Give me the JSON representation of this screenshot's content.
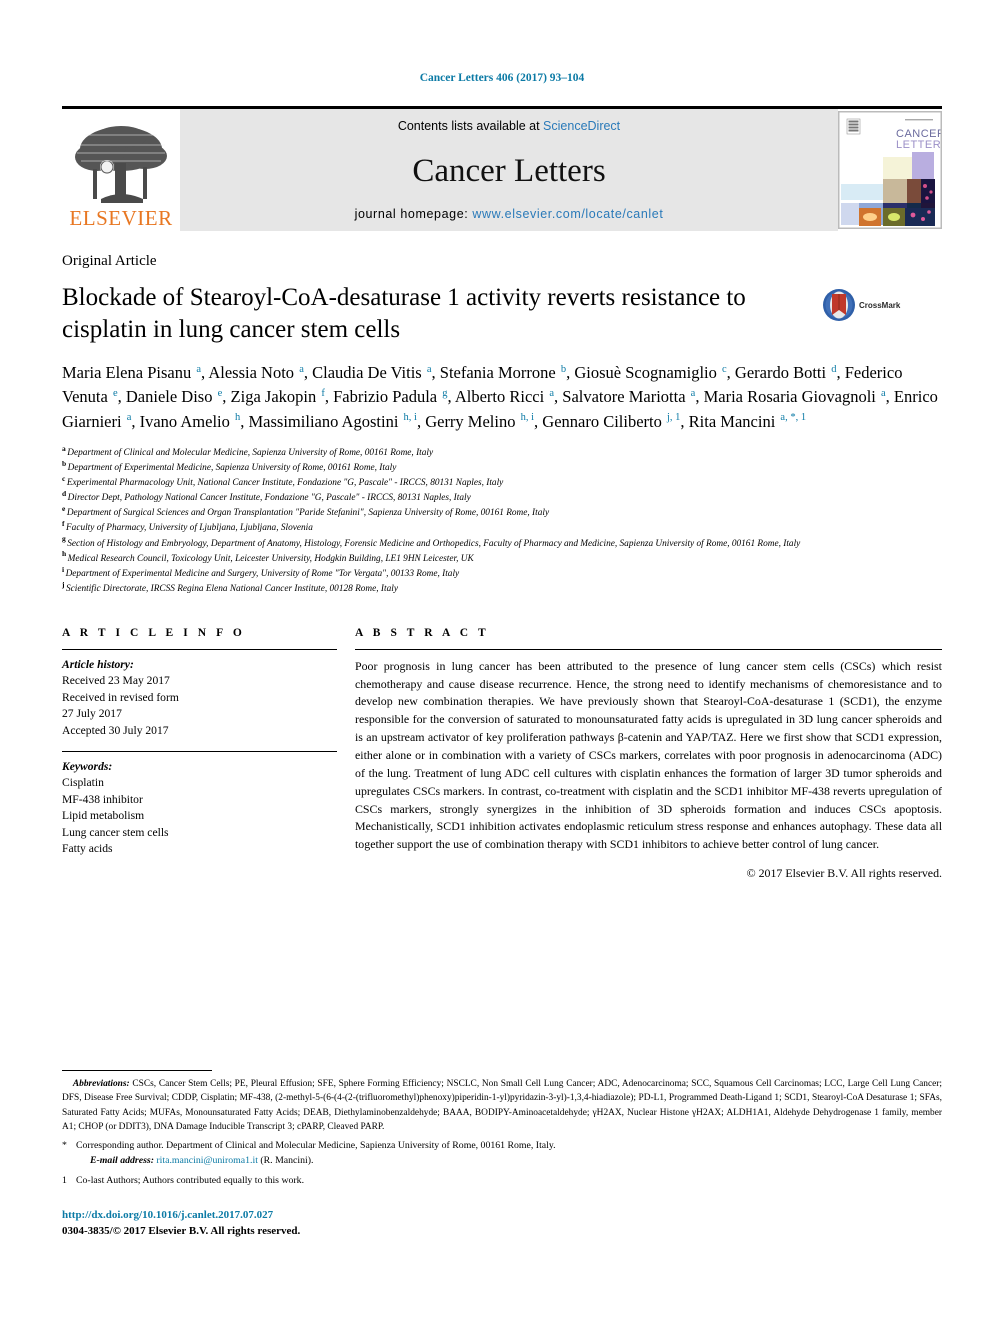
{
  "running_head": "Cancer Letters 406 (2017) 93–104",
  "masthead": {
    "contents_prefix": "Contents lists available at ",
    "sciencedirect": "ScienceDirect",
    "journal_title": "Cancer Letters",
    "homepage_prefix": "journal homepage: ",
    "homepage_url": "www.elsevier.com/locate/canlet",
    "publisher": "ELSEVIER",
    "cover_title_line1": "CANCER",
    "cover_title_line2": "LETTERS"
  },
  "article": {
    "type": "Original Article",
    "title": "Blockade of Stearoyl-CoA-desaturase 1 activity reverts resistance to cisplatin in lung cancer stem cells",
    "crossmark_label": "CrossMark"
  },
  "authors": [
    {
      "name": "Maria Elena Pisanu",
      "sup": "a",
      "sep": ","
    },
    {
      "name": "Alessia Noto",
      "sup": "a",
      "sep": ","
    },
    {
      "name": "Claudia De Vitis",
      "sup": "a",
      "sep": ","
    },
    {
      "name": "Stefania Morrone",
      "sup": "b",
      "sep": ","
    },
    {
      "name": "Giosuè Scognamiglio",
      "sup": "c",
      "sep": ","
    },
    {
      "name": "Gerardo Botti",
      "sup": "d",
      "sep": ","
    },
    {
      "name": "Federico Venuta",
      "sup": "e",
      "sep": ","
    },
    {
      "name": "Daniele Diso",
      "sup": "e",
      "sep": ","
    },
    {
      "name": "Ziga Jakopin",
      "sup": "f",
      "sep": ","
    },
    {
      "name": "Fabrizio Padula",
      "sup": "g",
      "sep": ","
    },
    {
      "name": "Alberto Ricci",
      "sup": "a",
      "sep": ","
    },
    {
      "name": "Salvatore Mariotta",
      "sup": "a",
      "sep": ","
    },
    {
      "name": "Maria Rosaria Giovagnoli",
      "sup": "a",
      "sep": ","
    },
    {
      "name": "Enrico Giarnieri",
      "sup": "a",
      "sep": ","
    },
    {
      "name": "Ivano Amelio",
      "sup": "h",
      "sep": ","
    },
    {
      "name": "Massimiliano Agostini",
      "sup": "h, i",
      "sep": ","
    },
    {
      "name": "Gerry Melino",
      "sup": "h, i",
      "sep": ","
    },
    {
      "name": "Gennaro Ciliberto",
      "sup": "j, 1",
      "sep": ","
    },
    {
      "name": "Rita Mancini",
      "sup": "a, *, 1",
      "sep": ""
    }
  ],
  "affiliations": [
    {
      "mark": "a",
      "text": "Department of Clinical and Molecular Medicine, Sapienza University of Rome, 00161 Rome, Italy"
    },
    {
      "mark": "b",
      "text": "Department of Experimental Medicine, Sapienza University of Rome, 00161 Rome, Italy"
    },
    {
      "mark": "c",
      "text": "Experimental Pharmacology Unit, National Cancer Institute, Fondazione \"G, Pascale\" - IRCCS, 80131 Naples, Italy"
    },
    {
      "mark": "d",
      "text": "Director Dept, Pathology National Cancer Institute, Fondazione \"G, Pascale\" - IRCCS, 80131 Naples, Italy"
    },
    {
      "mark": "e",
      "text": "Department of Surgical Sciences and Organ Transplantation \"Paride Stefanini\", Sapienza University of Rome, 00161 Rome, Italy"
    },
    {
      "mark": "f",
      "text": "Faculty of Pharmacy, University of Ljubljana, Ljubljana, Slovenia"
    },
    {
      "mark": "g",
      "text": "Section of Histology and Embryology, Department of Anatomy, Histology, Forensic Medicine and Orthopedics, Faculty of Pharmacy and Medicine, Sapienza University of Rome, 00161 Rome, Italy"
    },
    {
      "mark": "h",
      "text": "Medical Research Council, Toxicology Unit, Leicester University, Hodgkin Building, LE1 9HN Leicester, UK"
    },
    {
      "mark": "i",
      "text": "Department of Experimental Medicine and Surgery, University of Rome \"Tor Vergata\", 00133 Rome, Italy"
    },
    {
      "mark": "j",
      "text": "Scientific Directorate, IRCSS Regina Elena National Cancer Institute, 00128 Rome, Italy"
    }
  ],
  "article_info": {
    "heading": "A R T I C L E   I N F O",
    "history_label": "Article history:",
    "history_lines": [
      "Received 23 May 2017",
      "Received in revised form",
      "27 July 2017",
      "Accepted 30 July 2017"
    ],
    "keywords_label": "Keywords:",
    "keywords": [
      "Cisplatin",
      "MF-438 inhibitor",
      "Lipid metabolism",
      "Lung cancer stem cells",
      "Fatty acids"
    ]
  },
  "abstract": {
    "heading": "A B S T R A C T",
    "body": "Poor prognosis in lung cancer has been attributed to the presence of lung cancer stem cells (CSCs) which resist chemotherapy and cause disease recurrence. Hence, the strong need to identify mechanisms of chemoresistance and to develop new combination therapies. We have previously shown that Stearoyl-CoA-desaturase 1 (SCD1), the enzyme responsible for the conversion of saturated to monounsaturated fatty acids is upregulated in 3D lung cancer spheroids and is an upstream activator of key proliferation pathways β-catenin and YAP/TAZ. Here we first show that SCD1 expression, either alone or in combination with a variety of CSCs markers, correlates with poor prognosis in adenocarcinoma (ADC) of the lung. Treatment of lung ADC cell cultures with cisplatin enhances the formation of larger 3D tumor spheroids and upregulates CSCs markers. In contrast, co-treatment with cisplatin and the SCD1 inhibitor MF-438 reverts upregulation of CSCs markers, strongly synergizes in the inhibition of 3D spheroids formation and induces CSCs apoptosis. Mechanistically, SCD1 inhibition activates endoplasmic reticulum stress response and enhances autophagy. These data all together support the use of combination therapy with SCD1 inhibitors to achieve better control of lung cancer.",
    "copyright": "© 2017 Elsevier B.V. All rights reserved."
  },
  "footnotes": {
    "abbrev_label": "Abbreviations:",
    "abbrev_text": " CSCs, Cancer Stem Cells; PE, Pleural Effusion; SFE, Sphere Forming Efficiency; NSCLC, Non Small Cell Lung Cancer; ADC, Adenocarcinoma; SCC, Squamous Cell Carcinomas; LCC, Large Cell Lung Cancer; DFS, Disease Free Survival; CDDP, Cisplatin; MF-438, (2-methyl-5-(6-(4-(2-(trifluoromethyl)phenoxy)piperidin-1-yl)pyridazin-3-yl)-1,3,4-hiadiazole); PD-L1, Programmed Death-Ligand 1; SCD1, Stearoyl-CoA Desaturase 1; SFAs, Saturated Fatty Acids; MUFAs, Monounsaturated Fatty Acids; DEAB, Diethylaminobenzaldehyde; BAAA, BODIPY-Aminoacetaldehyde; γH2AX, Nuclear Histone γH2AX; ALDH1A1, Aldehyde Dehydrogenase 1 family, member A1; CHOP (or DDIT3), DNA Damage Inducible Transcript 3; cPARP, Cleaved PARP.",
    "corresponding_mark": "*",
    "corresponding_text": "Corresponding author. Department of Clinical and Molecular Medicine, Sapienza University of Rome, 00161 Rome, Italy.",
    "email_label": "E-mail address:",
    "email": "rita.mancini@uniroma1.it",
    "email_suffix": " (R. Mancini).",
    "colast_mark": "1",
    "colast_text": "Co-last Authors; Authors contributed equally to this work.",
    "doi_url": "http://dx.doi.org/10.1016/j.canlet.2017.07.027",
    "issn_line": "0304-3835/© 2017 Elsevier B.V. All rights reserved."
  },
  "colors": {
    "link_teal": "#0b7aa5",
    "link_blue": "#2a7ab9",
    "elsevier_orange": "#e87722",
    "masthead_bg": "#e6e6e6"
  }
}
